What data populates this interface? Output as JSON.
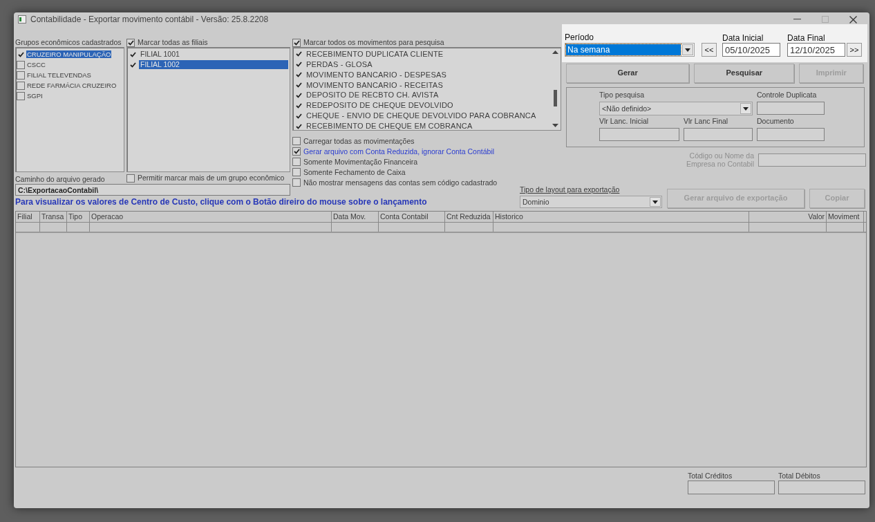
{
  "window": {
    "title": "Contabilidade - Exportar movimento contábil - Versão: 25.8.2208"
  },
  "groups": {
    "label": "Grupos econômicos cadastrados",
    "items": [
      {
        "label": "CRUZEIRO MANIPULAÇÃO",
        "checked": true,
        "selected": true
      },
      {
        "label": "CSCC",
        "checked": false,
        "selected": false
      },
      {
        "label": "FILIAL TELEVENDAS",
        "checked": false,
        "selected": false
      },
      {
        "label": "REDE FARMÁCIA CRUZEIRO",
        "checked": false,
        "selected": false
      },
      {
        "label": "SGPI",
        "checked": false,
        "selected": false
      }
    ]
  },
  "branches": {
    "select_all": {
      "label": "Marcar todas as filiais",
      "checked": true
    },
    "items": [
      {
        "label": "FILIAL 1001",
        "checked": true,
        "selected": false
      },
      {
        "label": "FILIAL 1002",
        "checked": true,
        "selected": true
      }
    ]
  },
  "path": {
    "label": "Caminho do arquivo gerado",
    "value": "C:\\ExportacaoContabil\\"
  },
  "allow_multiple": {
    "label": "Permitir marcar mais de um grupo econômico",
    "checked": false
  },
  "hint": "Para visualizar os valores de Centro de Custo, clique com o Botão direiro do mouse sobre o lançamento",
  "movements": {
    "select_all": {
      "label": "Marcar todos os movimentos para pesquisa",
      "checked": true
    },
    "items": [
      {
        "label": "RECEBIMENTO DUPLICATA CLIENTE",
        "checked": true,
        "selected": false
      },
      {
        "label": "PERDAS - GLOSA",
        "checked": true,
        "selected": false
      },
      {
        "label": "MOVIMENTO BANCARIO - DESPESAS",
        "checked": true,
        "selected": false
      },
      {
        "label": "MOVIMENTO BANCARIO - RECEITAS",
        "checked": true,
        "selected": false
      },
      {
        "label": "DEPOSITO DE RECBTO CH. AVISTA",
        "checked": true,
        "selected": false
      },
      {
        "label": "REDEPOSITO DE CHEQUE DEVOLVIDO",
        "checked": true,
        "selected": false
      },
      {
        "label": "CHEQUE - ENVIO DE CHEQUE DEVOLVIDO PARA COBRANCA",
        "checked": true,
        "selected": false
      },
      {
        "label": "RECEBIMENTO DE CHEQUE EM COBRANCA",
        "checked": true,
        "selected": false
      }
    ]
  },
  "options": [
    {
      "label": "Carregar todas as movimentações",
      "checked": false,
      "kind": "plain"
    },
    {
      "label": "Gerar arquivo com Conta Reduzida, ignorar Conta Contábil",
      "checked": true,
      "kind": "accent"
    },
    {
      "label": "Somente Movimentação Financeira",
      "checked": false,
      "kind": "plain"
    },
    {
      "label": "Somente Fechamento de Caixa",
      "checked": false,
      "kind": "plain"
    },
    {
      "label": "Não mostrar mensagens das contas sem código cadastrado",
      "checked": false,
      "kind": "plain"
    }
  ],
  "period": {
    "label": "Período",
    "value": "Na semana",
    "prev_button": "<<",
    "start_date": {
      "label": "Data Inicial",
      "value": "05/10/2025"
    },
    "end_date": {
      "label": "Data Final",
      "value": "12/10/2025"
    },
    "next_button": ">>"
  },
  "actions": [
    {
      "label": "Gerar",
      "disabled": false
    },
    {
      "label": "Pesquisar",
      "disabled": false
    },
    {
      "label": "Imprimir",
      "disabled": true
    }
  ],
  "search": {
    "type": {
      "label": "Tipo pesquisa",
      "value": "<Não definido>"
    },
    "duplicate_control": {
      "label": "Controle Duplicata"
    },
    "initial_value": {
      "label": "Vlr Lanc. Inicial"
    },
    "final_value": {
      "label": "Vlr Lanc Final"
    },
    "document": {
      "label": "Documento"
    }
  },
  "company": {
    "label": "Código ou Nome da Empresa no Contabil"
  },
  "layout": {
    "label": "Tipo de layout para exportação",
    "value": "Dominio"
  },
  "export_buttons": [
    {
      "label": "Gerar arquivo de exportação",
      "disabled": true
    },
    {
      "label": "Copiar",
      "disabled": true
    }
  ],
  "table": {
    "columns": [
      {
        "label": "Filial"
      },
      {
        "label": "Transa"
      },
      {
        "label": "Tipo"
      },
      {
        "label": "Operacao"
      },
      {
        "label": "Data Mov."
      },
      {
        "label": "Conta Contabil"
      },
      {
        "label": "Cnt Reduzida"
      },
      {
        "label": "Historico"
      },
      {
        "label": "Valor"
      },
      {
        "label": "Moviment"
      }
    ]
  },
  "totals": [
    {
      "label": "Total Créditos"
    },
    {
      "label": "Total Débitos"
    }
  ]
}
